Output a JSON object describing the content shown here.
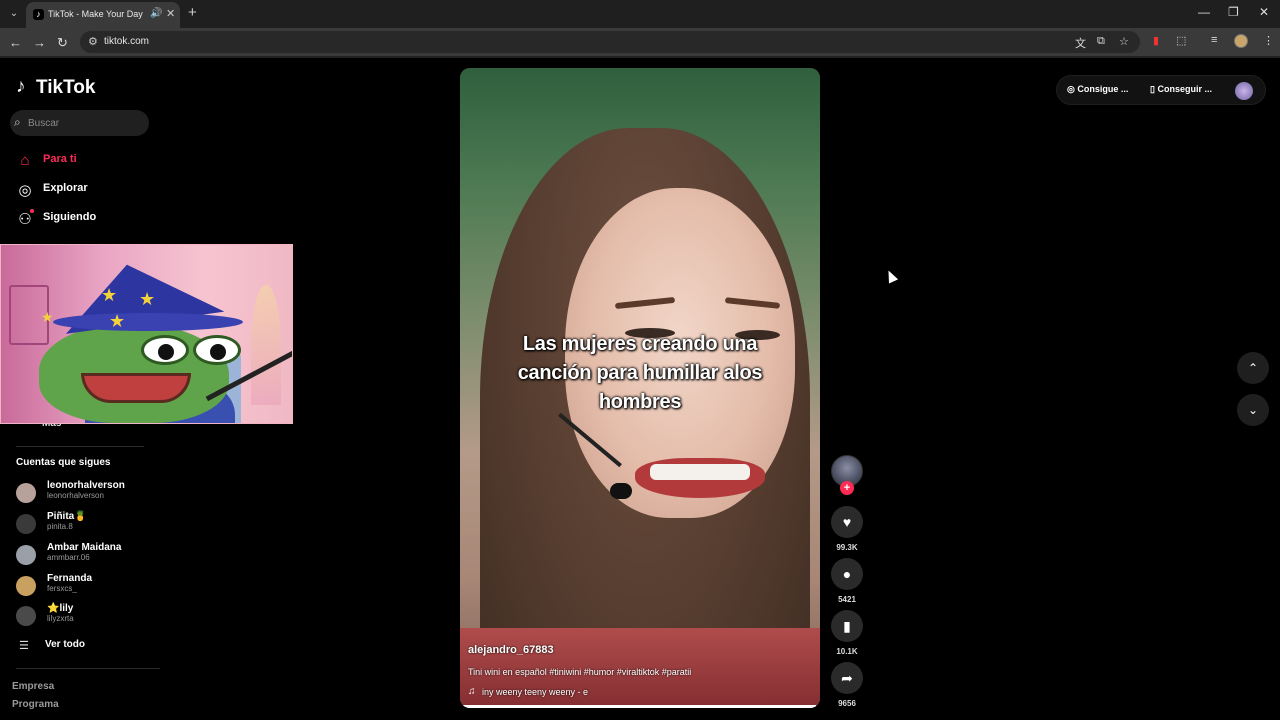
{
  "browser": {
    "tab_title": "TikTok - Make Your Day",
    "tab_favicon": "tiktok-logo",
    "new_tab": "+",
    "url": "tiktok.com",
    "icons": [
      "tab-search-icon",
      "audio-icon",
      "close-icon",
      "back-icon",
      "forward-icon",
      "reload-icon",
      "site-info-icon",
      "translate-icon",
      "install-app-icon",
      "star-icon",
      "media-icon",
      "extensions-icon",
      "reading-list-icon",
      "profile-icon",
      "menu-icon"
    ]
  },
  "sidebar": {
    "logo_text": "TikTok",
    "search_placeholder": "Buscar",
    "nav": [
      {
        "label": "Para ti",
        "icon": "home-icon",
        "active": true
      },
      {
        "label": "Explorar",
        "icon": "compass-icon",
        "active": false
      },
      {
        "label": "Siguiendo",
        "icon": "following-icon",
        "active": false
      }
    ],
    "more_label": "Más",
    "following_title": "Cuentas que sigues",
    "accounts": [
      {
        "name": "leonorhalverson",
        "username": "leonorhalverson",
        "color": "#b8a19a"
      },
      {
        "name": "Piñita🍍",
        "username": "pinita.8",
        "color": "#3a3a3a"
      },
      {
        "name": "Ambar Maidana",
        "username": "ammbarr.06",
        "color": "#9aa0a8"
      },
      {
        "name": "Fernanda",
        "username": "fersxcs_",
        "color": "#c8a060"
      },
      {
        "name": "⭐lily",
        "username": "lilyzxrta",
        "color": "#4a4a4a"
      }
    ],
    "see_all": "Ver todo",
    "footer_links": [
      "Empresa",
      "Programa"
    ]
  },
  "video": {
    "caption": "Las mujeres creando una canción para humillar alos hombres",
    "author": "alejandro_67883",
    "description": "Tini wini en español #tiniwini #humor #viraltiktok #paratii",
    "music": "iny weeny teeny weeny - e",
    "progress_fraction": 0.99
  },
  "actions": {
    "likes": "99.3K",
    "comments": "5421",
    "saves": "10.1K",
    "shares": "9656"
  },
  "topright": {
    "get_coins": "Consigue ...",
    "get_app": "Conseguir ..."
  }
}
